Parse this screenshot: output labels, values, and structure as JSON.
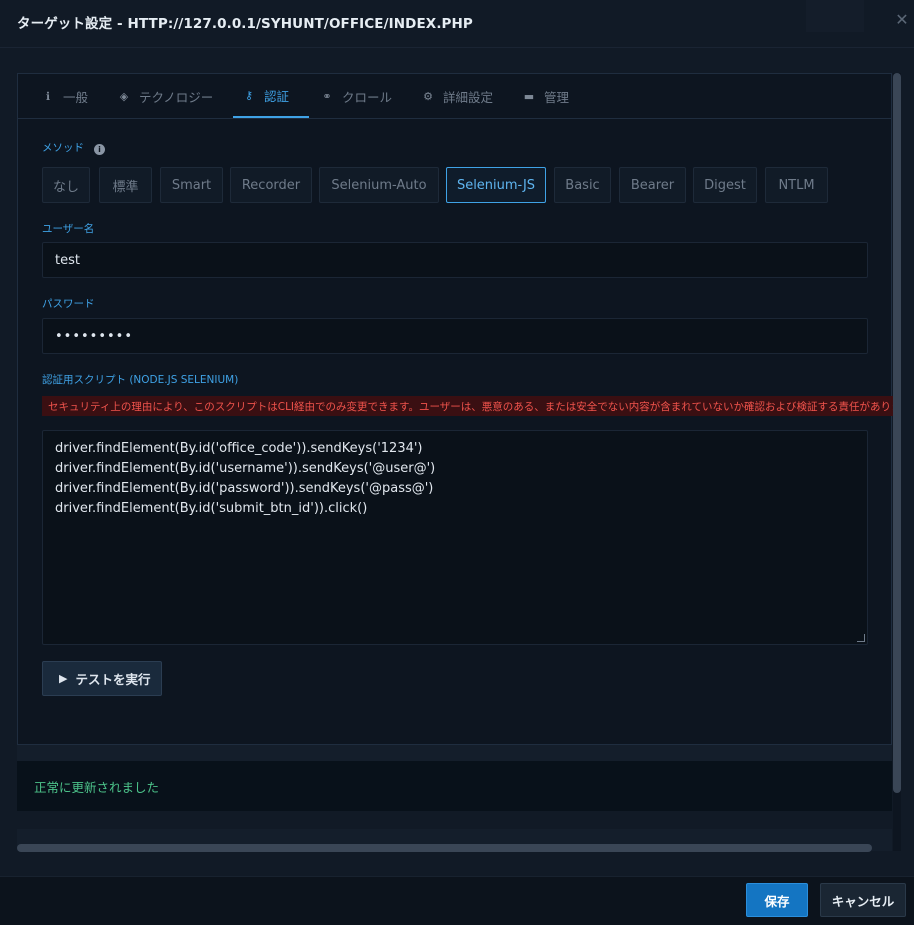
{
  "dialog": {
    "title": "ターゲット設定 - HTTP://127.0.0.1/SYHUNT/OFFICE/INDEX.PHP",
    "close_glyph": "✕"
  },
  "tabs": [
    {
      "label": "一般",
      "icon": "info-icon",
      "glyph": "ℹ",
      "active": false
    },
    {
      "label": "テクノロジー",
      "icon": "cube-icon",
      "glyph": "◈",
      "active": false
    },
    {
      "label": "認証",
      "icon": "key-icon",
      "glyph": "⚷",
      "active": true
    },
    {
      "label": "クロール",
      "icon": "link-icon",
      "glyph": "⚭",
      "active": false
    },
    {
      "label": "詳細設定",
      "icon": "gear-icon",
      "glyph": "⚙",
      "active": false
    },
    {
      "label": "管理",
      "icon": "briefcase-icon",
      "glyph": "▬",
      "active": false
    }
  ],
  "method": {
    "label": "メソッド",
    "options": [
      "なし",
      "標準",
      "Smart",
      "Recorder",
      "Selenium-Auto",
      "Selenium-JS",
      "Basic",
      "Bearer",
      "Digest",
      "NTLM"
    ],
    "selected": "Selenium-JS"
  },
  "username": {
    "label": "ユーザー名",
    "value": "test"
  },
  "password": {
    "label": "パスワード",
    "value": "•••••••••"
  },
  "script": {
    "label": "認証用スクリプト (NODE.JS SELENIUM)",
    "warning": "セキュリティ上の理由により、このスクリプトはCLI経由でのみ変更できます。ユーザーは、悪意のある、または安全でない内容が含まれていないか確認および検証する責任があります。",
    "lines": [
      "driver.findElement(By.id('office_code')).sendKeys('1234')",
      "driver.findElement(By.id('username')).sendKeys('@user@')",
      "driver.findElement(By.id('password')).sendKeys('@pass@')",
      "driver.findElement(By.id('submit_btn_id')).click()"
    ]
  },
  "run_test": {
    "label": "テストを実行",
    "glyph": "▶"
  },
  "status": {
    "message": "正常に更新されました",
    "color": "#4cc38a"
  },
  "footer": {
    "save_label": "保存",
    "cancel_label": "キャンセル"
  },
  "colors": {
    "accent": "#3fa2e6",
    "warning_text": "#f0534c",
    "save_button": "#1475c2"
  }
}
